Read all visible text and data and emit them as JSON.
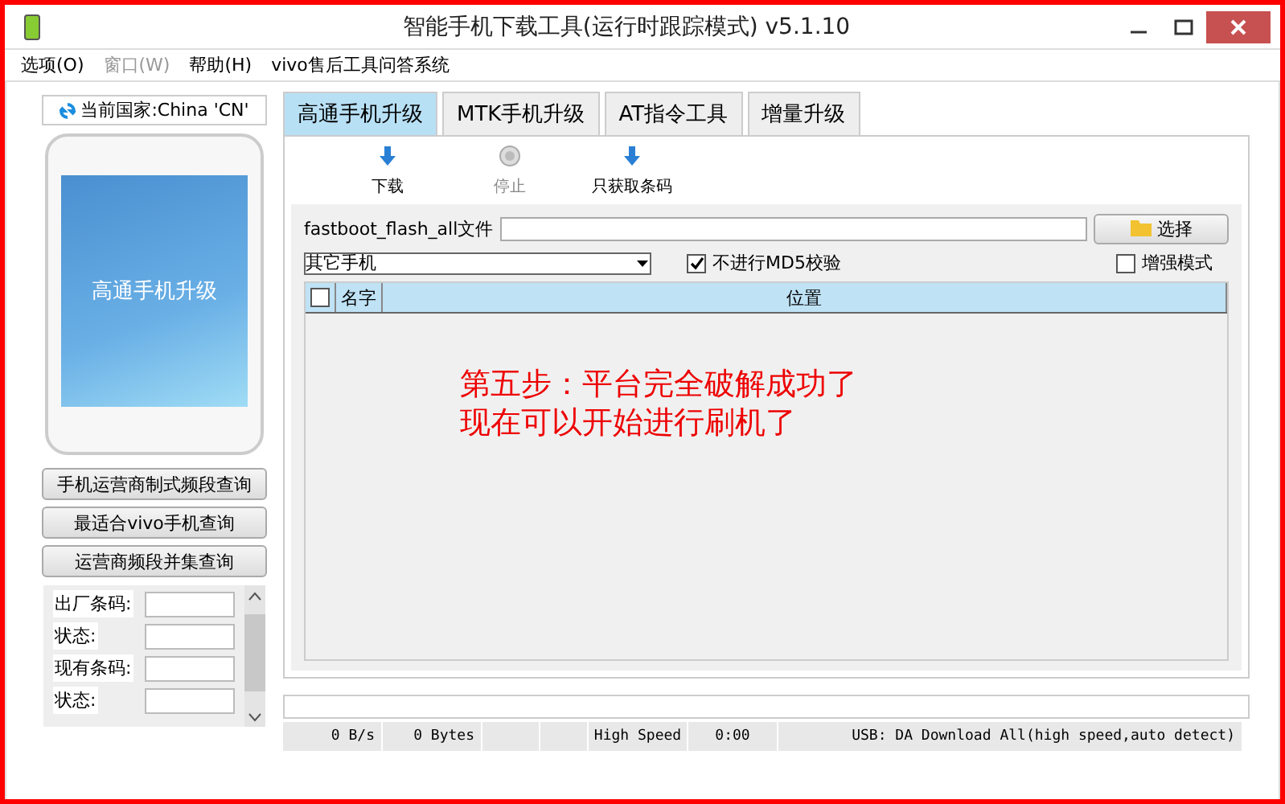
{
  "window": {
    "title": "智能手机下载工具(运行时跟踪模式)  v5.1.10"
  },
  "menu": [
    {
      "label": "选项(O)",
      "disabled": false
    },
    {
      "label": "窗口(W)",
      "disabled": true
    },
    {
      "label": "帮助(H)",
      "disabled": false
    },
    {
      "label": "vivo售后工具问答系统",
      "disabled": false
    }
  ],
  "sidebar": {
    "country": "当前国家:China 'CN'",
    "phone_screen_text": "高通手机升级",
    "buttons": [
      "手机运营商制式频段查询",
      "最适合vivo手机查询",
      "运营商频段并集查询"
    ],
    "fields": [
      {
        "label": "出厂条码:"
      },
      {
        "label": "状态:"
      },
      {
        "label": "现有条码:"
      },
      {
        "label": "状态:"
      }
    ]
  },
  "tabs": [
    {
      "label": "高通手机升级",
      "selected": true
    },
    {
      "label": "MTK手机升级",
      "selected": false
    },
    {
      "label": "AT指令工具",
      "selected": false
    },
    {
      "label": "增量升级",
      "selected": false
    }
  ],
  "toolbar": [
    {
      "label": "下载",
      "kind": "download",
      "disabled": false
    },
    {
      "label": "停止",
      "kind": "stop",
      "disabled": true
    },
    {
      "label": "只获取条码",
      "kind": "download",
      "disabled": false
    }
  ],
  "file_row": {
    "label": "fastboot_flash_all文件",
    "button": "选择"
  },
  "progress": {
    "level": 0
  },
  "options": {
    "phone_type": "其它手机",
    "skip_md5": {
      "label": "不进行MD5校验",
      "checked": true
    },
    "enhanced": {
      "label": "增强模式",
      "checked": false
    }
  },
  "table": {
    "select_all": false,
    "columns": [
      "名字",
      "位置"
    ]
  },
  "annotation": [
    "第五步：平台完全破解成功了",
    "现在可以开始进行刷机了"
  ],
  "status_bar": [
    {
      "kind": "text",
      "text": "0 B/s"
    },
    {
      "kind": "text",
      "text": "0 Bytes"
    },
    {
      "kind": "blank"
    },
    {
      "kind": "blank"
    },
    {
      "kind": "text",
      "text": "High Speed"
    },
    {
      "kind": "text",
      "text": "0:00"
    },
    {
      "kind": "text",
      "text": "USB: DA Download All(high speed,auto detect)"
    }
  ]
}
